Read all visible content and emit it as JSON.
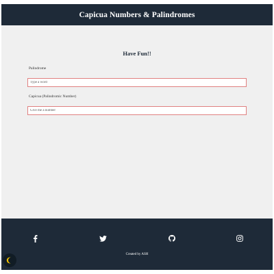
{
  "header": {
    "title": "Capicua Numbers & Palindromes"
  },
  "main": {
    "heading": "Have Fun!!",
    "palindrome": {
      "label": "Palindrome",
      "placeholder": "Type a word",
      "value": ""
    },
    "capicua": {
      "label": "Capicua (Palindromic Number)",
      "placeholder": "Give me a number",
      "value": ""
    }
  },
  "footer": {
    "social": [
      {
        "name": "facebook",
        "icon": "facebook-icon"
      },
      {
        "name": "twitter",
        "icon": "twitter-icon"
      },
      {
        "name": "github",
        "icon": "github-icon"
      },
      {
        "name": "instagram",
        "icon": "instagram-icon"
      }
    ],
    "credit": "Created by ASH"
  },
  "theme_toggle": {
    "icon": "moon-icon",
    "color": "#f2c200"
  },
  "colors": {
    "header_bg": "#1e2a38",
    "main_bg": "#f0f0f0",
    "input_border": "#e08080",
    "footer_bg": "#1e2a38"
  }
}
